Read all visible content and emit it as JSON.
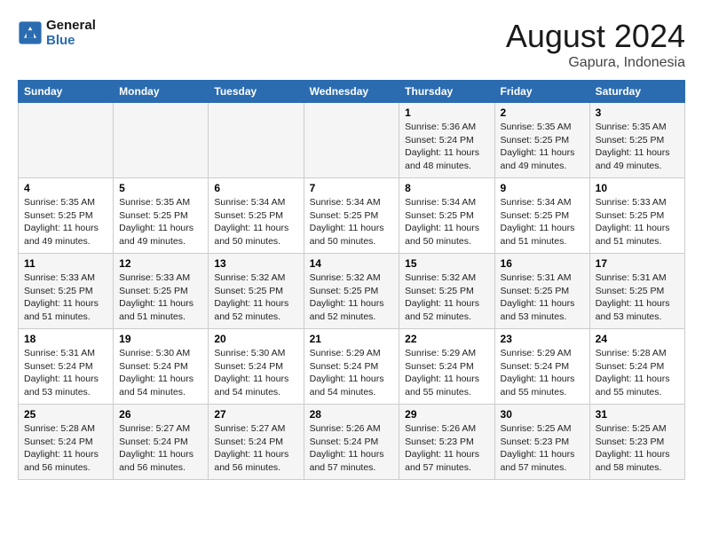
{
  "logo": {
    "line1": "General",
    "line2": "Blue"
  },
  "title": "August 2024",
  "location": "Gapura, Indonesia",
  "days_of_week": [
    "Sunday",
    "Monday",
    "Tuesday",
    "Wednesday",
    "Thursday",
    "Friday",
    "Saturday"
  ],
  "weeks": [
    [
      {
        "day": "",
        "info": ""
      },
      {
        "day": "",
        "info": ""
      },
      {
        "day": "",
        "info": ""
      },
      {
        "day": "",
        "info": ""
      },
      {
        "day": "1",
        "info": "Sunrise: 5:36 AM\nSunset: 5:24 PM\nDaylight: 11 hours and 48 minutes."
      },
      {
        "day": "2",
        "info": "Sunrise: 5:35 AM\nSunset: 5:25 PM\nDaylight: 11 hours and 49 minutes."
      },
      {
        "day": "3",
        "info": "Sunrise: 5:35 AM\nSunset: 5:25 PM\nDaylight: 11 hours and 49 minutes."
      }
    ],
    [
      {
        "day": "4",
        "info": "Sunrise: 5:35 AM\nSunset: 5:25 PM\nDaylight: 11 hours and 49 minutes."
      },
      {
        "day": "5",
        "info": "Sunrise: 5:35 AM\nSunset: 5:25 PM\nDaylight: 11 hours and 49 minutes."
      },
      {
        "day": "6",
        "info": "Sunrise: 5:34 AM\nSunset: 5:25 PM\nDaylight: 11 hours and 50 minutes."
      },
      {
        "day": "7",
        "info": "Sunrise: 5:34 AM\nSunset: 5:25 PM\nDaylight: 11 hours and 50 minutes."
      },
      {
        "day": "8",
        "info": "Sunrise: 5:34 AM\nSunset: 5:25 PM\nDaylight: 11 hours and 50 minutes."
      },
      {
        "day": "9",
        "info": "Sunrise: 5:34 AM\nSunset: 5:25 PM\nDaylight: 11 hours and 51 minutes."
      },
      {
        "day": "10",
        "info": "Sunrise: 5:33 AM\nSunset: 5:25 PM\nDaylight: 11 hours and 51 minutes."
      }
    ],
    [
      {
        "day": "11",
        "info": "Sunrise: 5:33 AM\nSunset: 5:25 PM\nDaylight: 11 hours and 51 minutes."
      },
      {
        "day": "12",
        "info": "Sunrise: 5:33 AM\nSunset: 5:25 PM\nDaylight: 11 hours and 51 minutes."
      },
      {
        "day": "13",
        "info": "Sunrise: 5:32 AM\nSunset: 5:25 PM\nDaylight: 11 hours and 52 minutes."
      },
      {
        "day": "14",
        "info": "Sunrise: 5:32 AM\nSunset: 5:25 PM\nDaylight: 11 hours and 52 minutes."
      },
      {
        "day": "15",
        "info": "Sunrise: 5:32 AM\nSunset: 5:25 PM\nDaylight: 11 hours and 52 minutes."
      },
      {
        "day": "16",
        "info": "Sunrise: 5:31 AM\nSunset: 5:25 PM\nDaylight: 11 hours and 53 minutes."
      },
      {
        "day": "17",
        "info": "Sunrise: 5:31 AM\nSunset: 5:25 PM\nDaylight: 11 hours and 53 minutes."
      }
    ],
    [
      {
        "day": "18",
        "info": "Sunrise: 5:31 AM\nSunset: 5:24 PM\nDaylight: 11 hours and 53 minutes."
      },
      {
        "day": "19",
        "info": "Sunrise: 5:30 AM\nSunset: 5:24 PM\nDaylight: 11 hours and 54 minutes."
      },
      {
        "day": "20",
        "info": "Sunrise: 5:30 AM\nSunset: 5:24 PM\nDaylight: 11 hours and 54 minutes."
      },
      {
        "day": "21",
        "info": "Sunrise: 5:29 AM\nSunset: 5:24 PM\nDaylight: 11 hours and 54 minutes."
      },
      {
        "day": "22",
        "info": "Sunrise: 5:29 AM\nSunset: 5:24 PM\nDaylight: 11 hours and 55 minutes."
      },
      {
        "day": "23",
        "info": "Sunrise: 5:29 AM\nSunset: 5:24 PM\nDaylight: 11 hours and 55 minutes."
      },
      {
        "day": "24",
        "info": "Sunrise: 5:28 AM\nSunset: 5:24 PM\nDaylight: 11 hours and 55 minutes."
      }
    ],
    [
      {
        "day": "25",
        "info": "Sunrise: 5:28 AM\nSunset: 5:24 PM\nDaylight: 11 hours and 56 minutes."
      },
      {
        "day": "26",
        "info": "Sunrise: 5:27 AM\nSunset: 5:24 PM\nDaylight: 11 hours and 56 minutes."
      },
      {
        "day": "27",
        "info": "Sunrise: 5:27 AM\nSunset: 5:24 PM\nDaylight: 11 hours and 56 minutes."
      },
      {
        "day": "28",
        "info": "Sunrise: 5:26 AM\nSunset: 5:24 PM\nDaylight: 11 hours and 57 minutes."
      },
      {
        "day": "29",
        "info": "Sunrise: 5:26 AM\nSunset: 5:23 PM\nDaylight: 11 hours and 57 minutes."
      },
      {
        "day": "30",
        "info": "Sunrise: 5:25 AM\nSunset: 5:23 PM\nDaylight: 11 hours and 57 minutes."
      },
      {
        "day": "31",
        "info": "Sunrise: 5:25 AM\nSunset: 5:23 PM\nDaylight: 11 hours and 58 minutes."
      }
    ]
  ]
}
